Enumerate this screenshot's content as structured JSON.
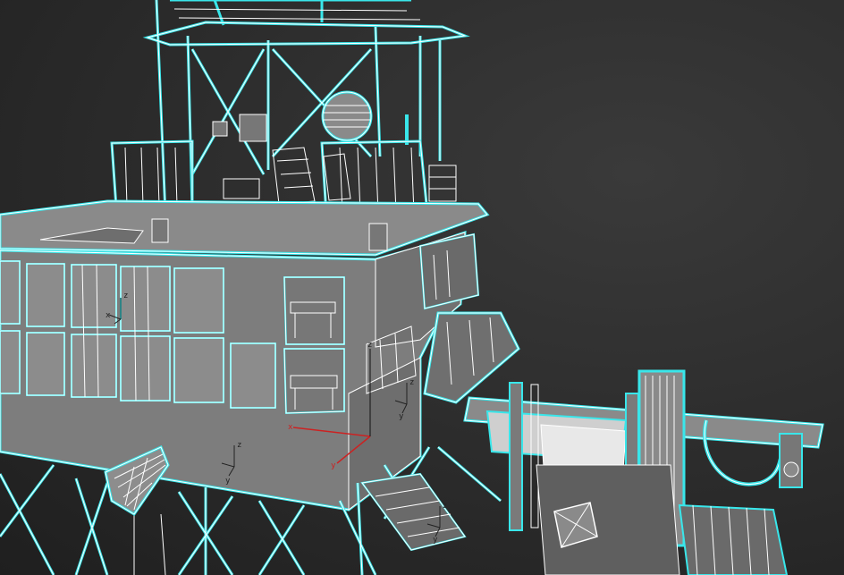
{
  "viewport": {
    "background": "#2b2b2b",
    "wire_color": "#ffffff",
    "selection_color": "#39e6ea",
    "surface_color": "#7d7d7d",
    "shade_color": "#5e5e5e",
    "gizmo_color": "#cc2222"
  },
  "gizmos": {
    "main": {
      "x": "x",
      "y": "y",
      "z": "z"
    },
    "small": {
      "x": "x",
      "y": "y",
      "z": "z"
    }
  }
}
